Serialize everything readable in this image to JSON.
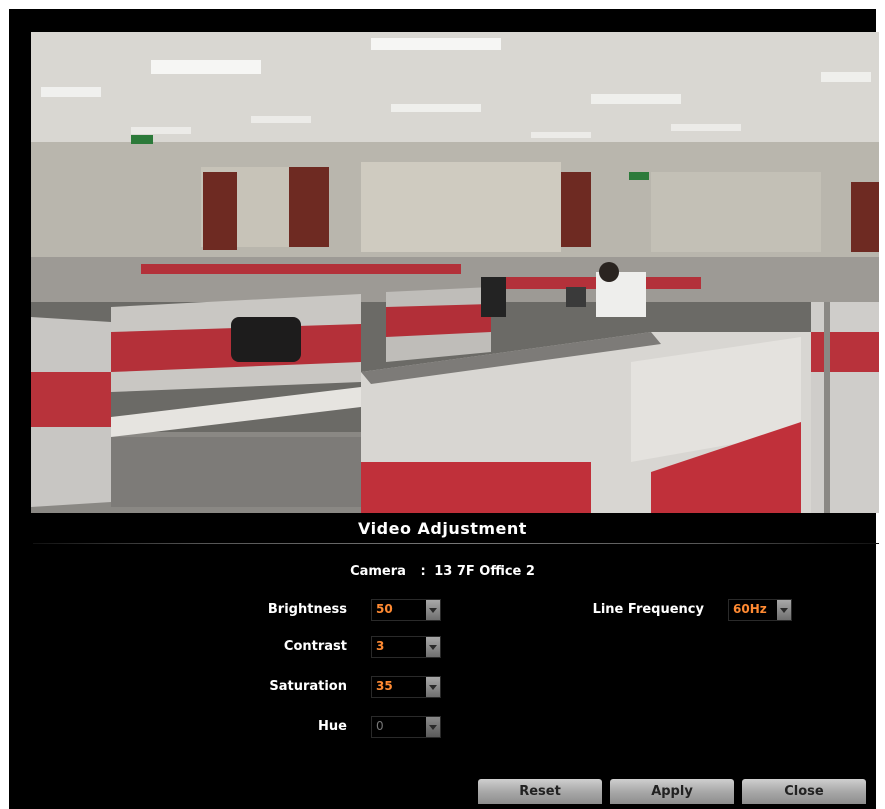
{
  "dialog": {
    "title": "Video Adjustment",
    "camera_label": "Camera",
    "camera_separator": ":",
    "camera_name": "13 7F Office 2"
  },
  "settings": {
    "brightness": {
      "label": "Brightness",
      "value": "50"
    },
    "contrast": {
      "label": "Contrast",
      "value": "3"
    },
    "saturation": {
      "label": "Saturation",
      "value": "35"
    },
    "hue": {
      "label": "Hue",
      "value": "0",
      "enabled": false
    },
    "line_frequency": {
      "label": "Line Frequency",
      "value": "60Hz"
    }
  },
  "buttons": {
    "reset": "Reset",
    "apply": "Apply",
    "close": "Close"
  },
  "colors": {
    "value_text": "#ff8a32",
    "background": "#000000",
    "cubicle_red": "#c0303a"
  },
  "icons": [
    "dropdown-arrow-icon"
  ]
}
